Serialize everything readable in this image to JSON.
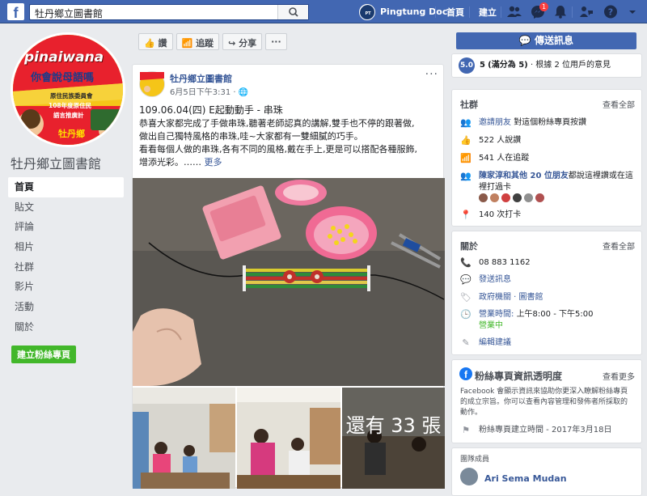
{
  "topbar": {
    "search_value": "牡丹鄉立圖書館",
    "profile_name": "Pingtung Doc",
    "home_label": "首頁",
    "create_label": "建立",
    "notification_count": "1",
    "accent": "#4267b2"
  },
  "sidebar": {
    "page_name": "牡丹鄉立圖書館",
    "cover_texts": [
      "pinaiwana",
      "你會說母語嗎",
      "原住民族委員會",
      "108年度原住民",
      "語言推廣計",
      "牡丹鄉"
    ],
    "items": [
      {
        "label": "首頁",
        "active": true
      },
      {
        "label": "貼文"
      },
      {
        "label": "評論"
      },
      {
        "label": "相片"
      },
      {
        "label": "社群"
      },
      {
        "label": "影片"
      },
      {
        "label": "活動"
      },
      {
        "label": "關於"
      }
    ],
    "create_page_label": "建立粉絲專頁"
  },
  "actionbar": {
    "like_label": "讚",
    "follow_label": "追蹤",
    "share_label": "分享",
    "more_label": "···"
  },
  "post": {
    "author": "牡丹鄉立圖書館",
    "time": "6月5日下午3:31 · ",
    "headline": "109.06.04(四) E起動動手 - 串珠",
    "body_lines": [
      "恭喜大家都完成了手做串珠,聽著老師認真的講解,雙手也不停的跟著做,",
      "做出自己獨特風格的串珠,哇~大家都有一雙細膩的巧手。",
      "看看每個人做的串珠,各有不同的風格,戴在手上,更是可以搭配各種服飾,",
      "增添光彩。……"
    ],
    "see_more": "更多",
    "more_photos_label": "還有 33 張"
  },
  "right": {
    "message_label": "傳送訊息",
    "rating_value": "5.0",
    "rating_text_bold": "5",
    "rating_text": "(滿分為 5)",
    "rating_suffix": "· 根據 2 位用戶的意見",
    "community": {
      "title": "社群",
      "see_all": "查看全部",
      "invite_link": "邀請朋友",
      "invite_text": "對這個粉絲專頁按讚",
      "likes": "522 人說讚",
      "follows": "541 人在追蹤",
      "friends_link": "陳家淳和其他 20 位朋友",
      "friends_text": "都說這裡讚或在這裡打過卡",
      "checkins": "140 次打卡"
    },
    "about": {
      "title": "關於",
      "see_all": "查看全部",
      "phone": "08 883 1162",
      "send_message": "發送訊息",
      "category": "政府機關 · 圖書館",
      "hours_label": "營業時間:",
      "hours": "上午8:00 - 下午5:00",
      "open_now": "營業中",
      "suggest_edit": "編輯建議"
    },
    "transparency": {
      "title": "粉絲專頁資訊透明度",
      "see_more": "查看更多",
      "desc_lines": [
        "Facebook 會顯示資訊來協助你更深入瞭解粉絲專頁",
        "的成立宗旨。你可以查看內容管理和發佈者所採取的",
        "動作。"
      ],
      "created": "粉絲專頁建立時間 - 2017年3月18日"
    },
    "members": {
      "title": "團隊成員",
      "name": "Ari Sema Mudan"
    }
  }
}
